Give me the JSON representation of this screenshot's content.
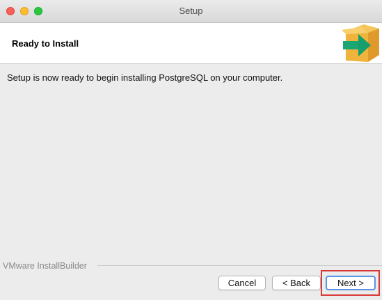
{
  "window": {
    "title": "Setup"
  },
  "header": {
    "title": "Ready to Install",
    "icon": "installer-box-arrow-icon"
  },
  "content": {
    "message": "Setup is now ready to begin installing PostgreSQL on your computer."
  },
  "footer": {
    "brand": "VMware InstallBuilder",
    "buttons": {
      "cancel": "Cancel",
      "back": "< Back",
      "next": "Next >"
    }
  },
  "colors": {
    "highlight": "#d9383a",
    "focus_ring": "#5a94e6",
    "icon_box": "#f0b43c",
    "icon_arrow": "#1aa774"
  }
}
